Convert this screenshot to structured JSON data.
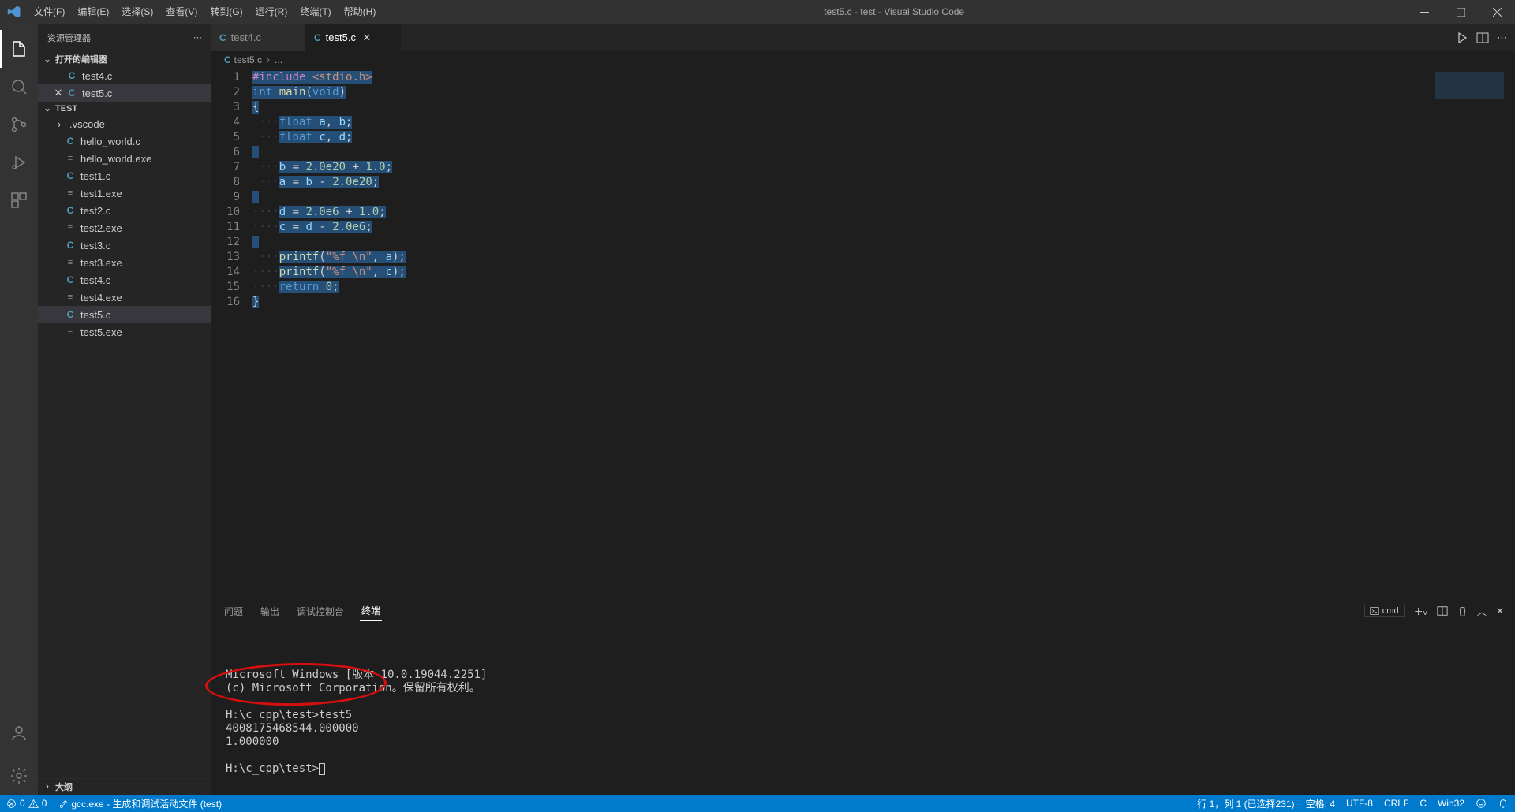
{
  "window": {
    "title": "test5.c - test - Visual Studio Code"
  },
  "menu": {
    "file": "文件(F)",
    "edit": "编辑(E)",
    "select": "选择(S)",
    "view": "查看(V)",
    "goto": "转到(G)",
    "run": "运行(R)",
    "terminal": "终端(T)",
    "help": "帮助(H)"
  },
  "sidebar": {
    "title": "资源管理器",
    "openEditorsLabel": "打开的编辑器",
    "openEditors": [
      {
        "name": "test4.c",
        "icon": "C",
        "active": false
      },
      {
        "name": "test5.c",
        "icon": "C",
        "active": true
      }
    ],
    "folderName": "TEST",
    "files": [
      {
        "name": ".vscode",
        "type": "folder"
      },
      {
        "name": "hello_world.c",
        "type": "c"
      },
      {
        "name": "hello_world.exe",
        "type": "exe"
      },
      {
        "name": "test1.c",
        "type": "c"
      },
      {
        "name": "test1.exe",
        "type": "exe"
      },
      {
        "name": "test2.c",
        "type": "c"
      },
      {
        "name": "test2.exe",
        "type": "exe"
      },
      {
        "name": "test3.c",
        "type": "c"
      },
      {
        "name": "test3.exe",
        "type": "exe"
      },
      {
        "name": "test4.c",
        "type": "c"
      },
      {
        "name": "test4.exe",
        "type": "exe"
      },
      {
        "name": "test5.c",
        "type": "c",
        "active": true
      },
      {
        "name": "test5.exe",
        "type": "exe"
      }
    ],
    "outlineLabel": "大纲"
  },
  "tabs": [
    {
      "name": "test4.c",
      "icon": "C",
      "active": false
    },
    {
      "name": "test5.c",
      "icon": "C",
      "active": true
    }
  ],
  "breadcrumb": {
    "file": "test5.c",
    "rest": "..."
  },
  "code": {
    "lineCount": 16,
    "lines": [
      {
        "n": 1,
        "html": "<span class='sel'><span class='tok-pp'>#include</span> <span class='tok-str'>&lt;stdio.h&gt;</span></span>"
      },
      {
        "n": 2,
        "html": "<span class='sel'><span class='tok-type'>int</span> <span class='tok-fn'>main</span>(<span class='tok-type'>void</span>)</span>"
      },
      {
        "n": 3,
        "html": "<span class='sel'>{</span>"
      },
      {
        "n": 4,
        "html": "<span class='tok-ws'>····</span><span class='sel'><span class='tok-type'>float</span> <span class='tok-var'>a</span>, <span class='tok-var'>b</span>;</span>"
      },
      {
        "n": 5,
        "html": "<span class='tok-ws'>····</span><span class='sel'><span class='tok-type'>float</span> <span class='tok-var'>c</span>, <span class='tok-var'>d</span>;</span>"
      },
      {
        "n": 6,
        "html": "<span class='sel'> </span>"
      },
      {
        "n": 7,
        "html": "<span class='tok-ws'>····</span><span class='sel'><span class='tok-var'>b</span> = <span class='tok-num'>2.0e20</span> + <span class='tok-num'>1.0</span>;</span>"
      },
      {
        "n": 8,
        "html": "<span class='tok-ws'>····</span><span class='sel'><span class='tok-var'>a</span> = <span class='tok-var'>b</span> - <span class='tok-num'>2.0e20</span>;</span>"
      },
      {
        "n": 9,
        "html": "<span class='sel'> </span>"
      },
      {
        "n": 10,
        "html": "<span class='tok-ws'>····</span><span class='sel'><span class='tok-var'>d</span> = <span class='tok-num'>2.0e6</span> + <span class='tok-num'>1.0</span>;</span>"
      },
      {
        "n": 11,
        "html": "<span class='tok-ws'>····</span><span class='sel'><span class='tok-var'>c</span> = <span class='tok-var'>d</span> - <span class='tok-num'>2.0e6</span>;</span>"
      },
      {
        "n": 12,
        "html": "<span class='sel'> </span>"
      },
      {
        "n": 13,
        "html": "<span class='tok-ws'>····</span><span class='sel'><span class='tok-fn'>printf</span>(<span class='tok-str'>\"%f \\n\"</span>, <span class='tok-var'>a</span>);</span>"
      },
      {
        "n": 14,
        "html": "<span class='tok-ws'>····</span><span class='sel'><span class='tok-fn'>printf</span>(<span class='tok-str'>\"%f \\n\"</span>, <span class='tok-var'>c</span>);</span>"
      },
      {
        "n": 15,
        "html": "<span class='tok-ws'>····</span><span class='sel'><span class='tok-kw'>return</span> <span class='tok-num'>0</span>;</span>"
      },
      {
        "n": 16,
        "html": "<span class='sel'>}</span>"
      }
    ]
  },
  "panel": {
    "tabs": {
      "problems": "问题",
      "output": "输出",
      "debugConsole": "调试控制台",
      "terminal": "终端"
    },
    "shell": "cmd",
    "terminalLines": [
      "Microsoft Windows [版本 10.0.19044.2251]",
      "(c) Microsoft Corporation。保留所有权利。",
      "",
      "H:\\c_cpp\\test>test5",
      "4008175468544.000000",
      "1.000000",
      "",
      "H:\\c_cpp\\test>"
    ]
  },
  "status": {
    "errors": "0",
    "warnings": "0",
    "build": "gcc.exe - 生成和调试活动文件 (test)",
    "lineCol": "行 1，列 1 (已选择231)",
    "spaces": "空格: 4",
    "encoding": "UTF-8",
    "eol": "CRLF",
    "lang": "C",
    "winTag": "Win32"
  }
}
